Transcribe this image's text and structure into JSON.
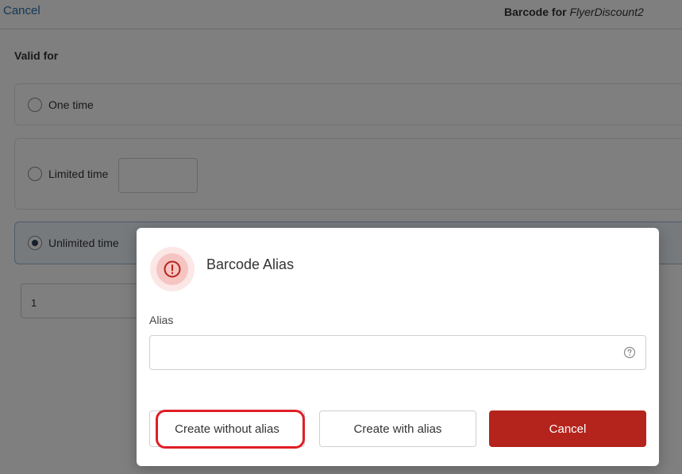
{
  "header": {
    "cancel_label": "Cancel",
    "title_prefix": "Barcode for ",
    "title_name": "FlyerDiscount2"
  },
  "valid_for": {
    "label": "Valid for",
    "options": [
      {
        "label": "One time",
        "selected": false
      },
      {
        "label": "Limited time",
        "selected": false
      },
      {
        "label": "Unlimited time",
        "selected": true
      }
    ],
    "count_value": "1"
  },
  "modal": {
    "title": "Barcode Alias",
    "icon": "alert-circle-icon",
    "alias_label": "Alias",
    "alias_value": "",
    "buttons": {
      "without_alias": "Create without alias",
      "with_alias": "Create with alias",
      "cancel": "Cancel"
    }
  },
  "colors": {
    "primary": "#b4241c",
    "highlight": "#e01e26",
    "link": "#2a6fb0"
  }
}
